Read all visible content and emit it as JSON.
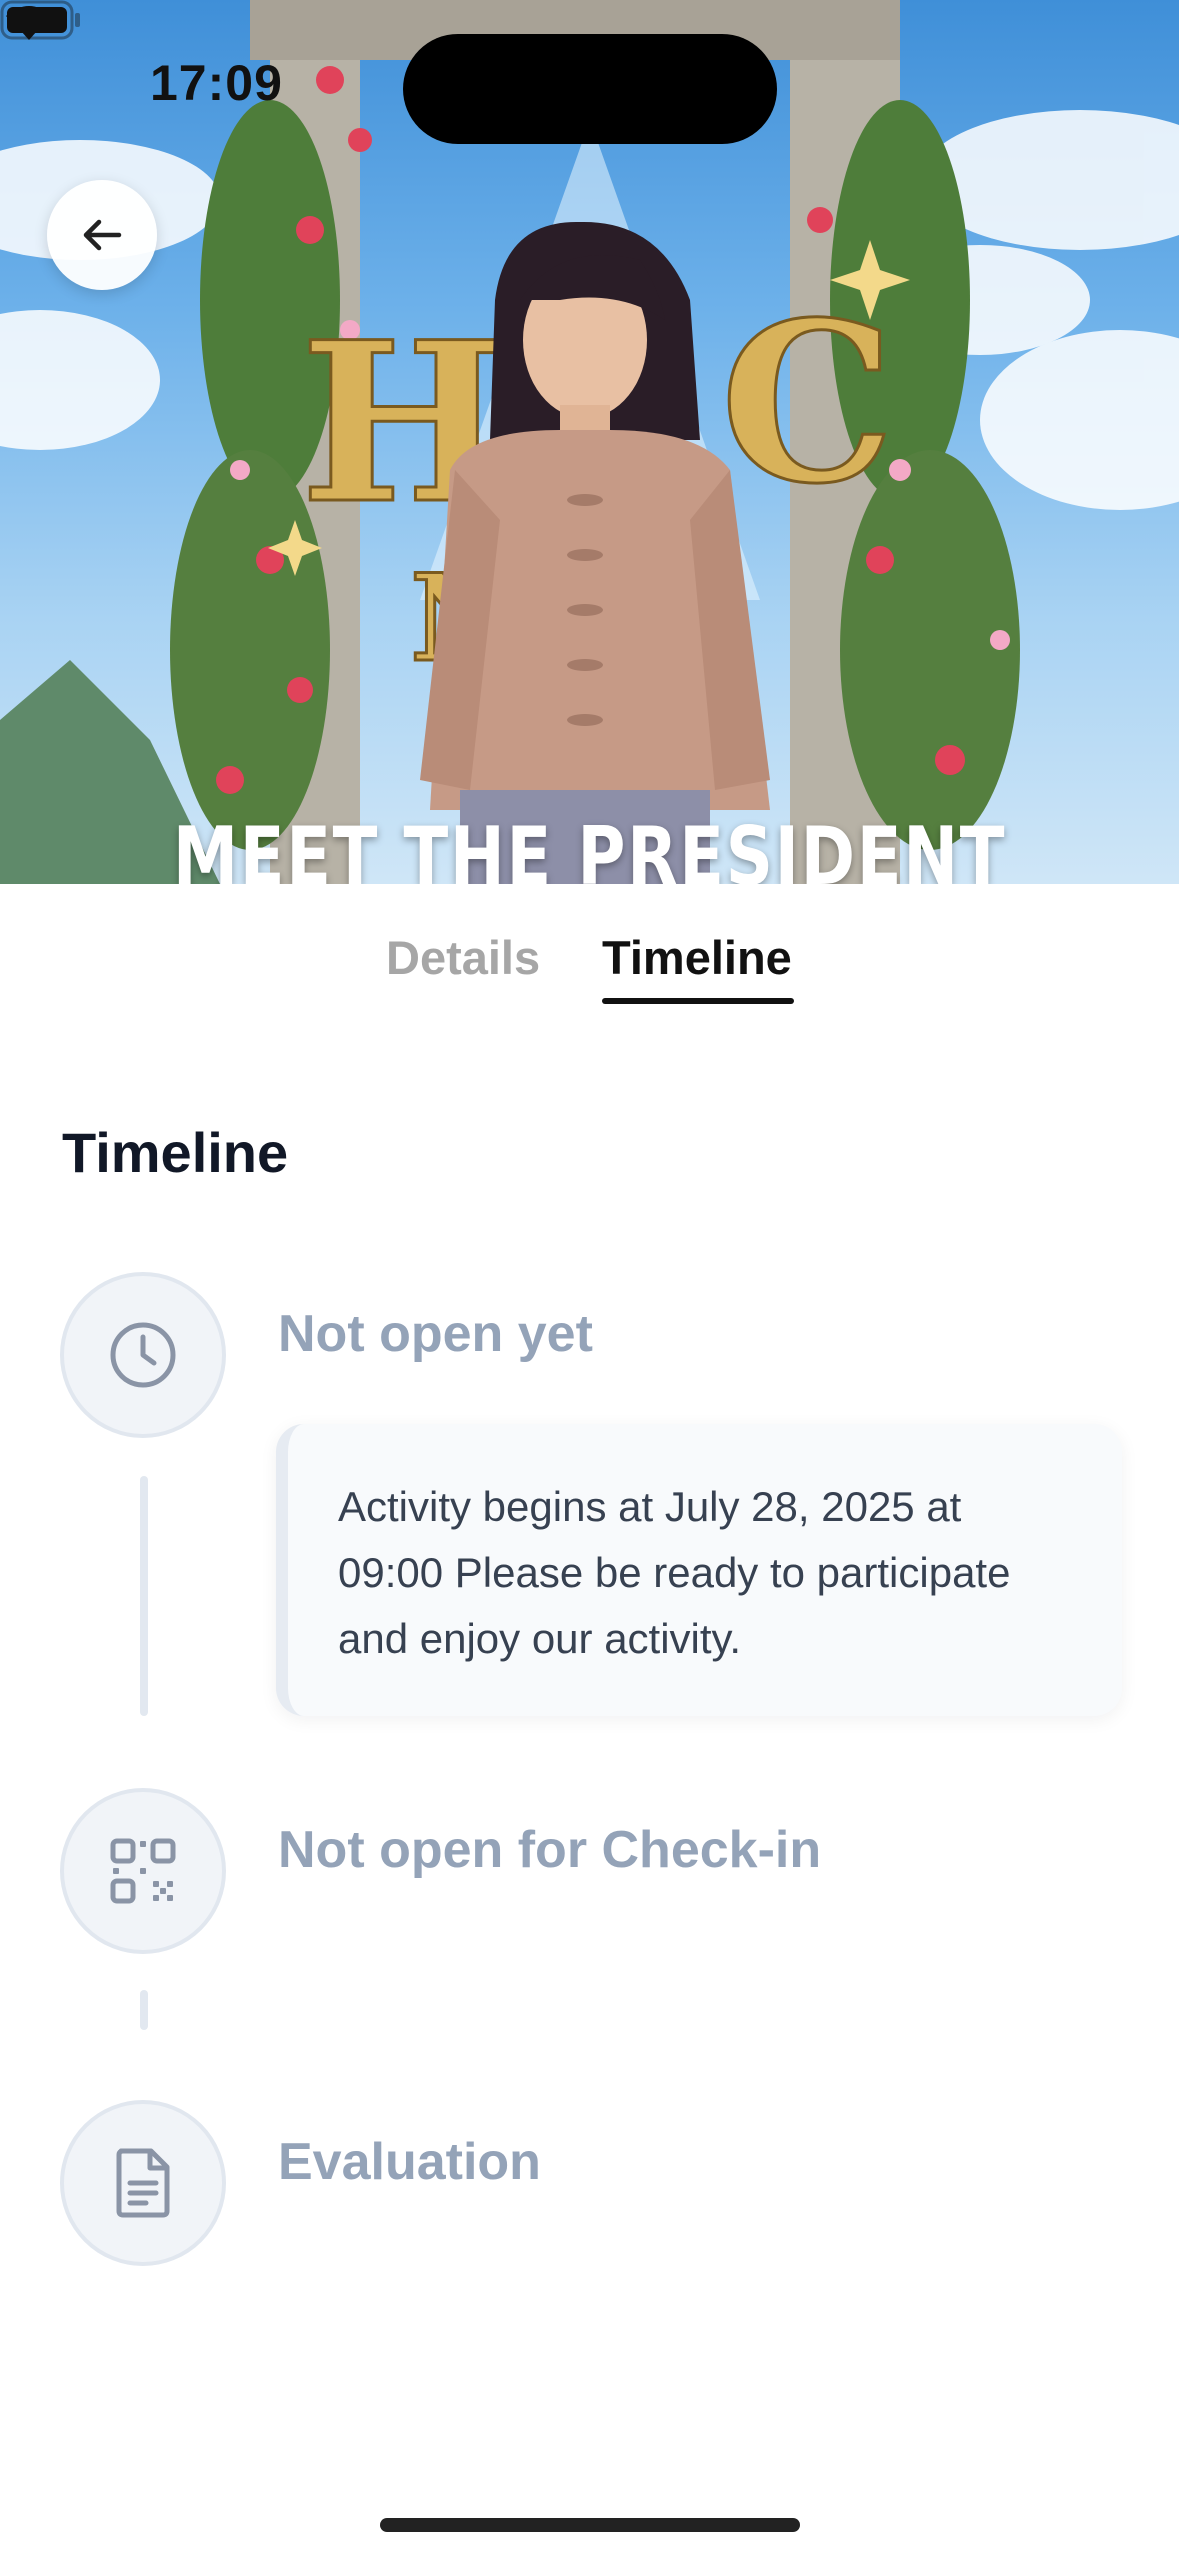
{
  "status_bar": {
    "time": "17:09"
  },
  "hero": {
    "banner_text": "MEET THE PRESIDENT"
  },
  "tabs": [
    {
      "label": "Details",
      "selected": false
    },
    {
      "label": "Timeline",
      "selected": true
    }
  ],
  "timeline": {
    "title": "Timeline",
    "steps": [
      {
        "title": "Not open yet",
        "icon": "clock-icon",
        "message": "Activity begins at July 28, 2025 at 09:00 Please be ready to participate and enjoy our activity."
      },
      {
        "title": "Not open for Check-in",
        "icon": "qr-code-icon"
      },
      {
        "title": "Evaluation",
        "icon": "document-icon"
      }
    ]
  },
  "colors": {
    "muted_step": "#94a3b8",
    "active_tab": "#111111",
    "inactive_tab": "#a6a6a6"
  }
}
